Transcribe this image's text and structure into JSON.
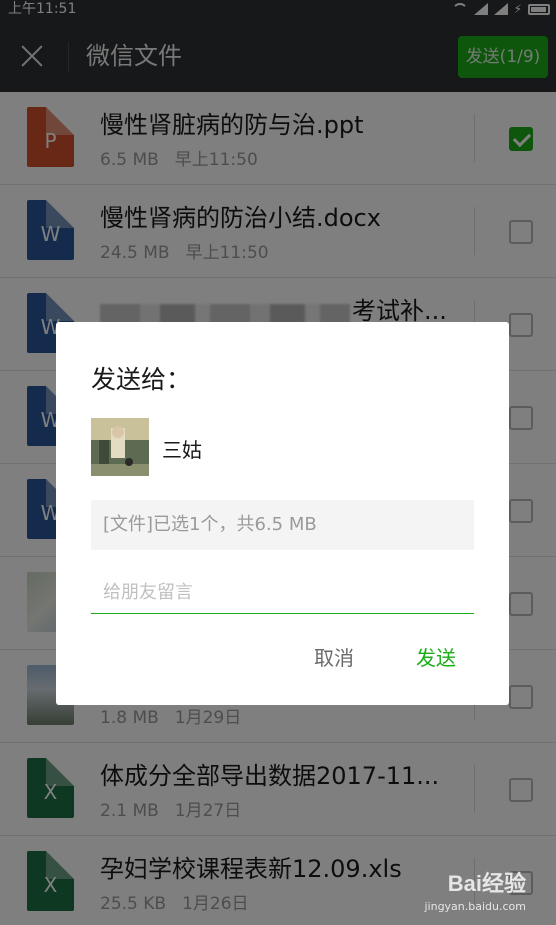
{
  "status_bar": {
    "time": "上午11:51"
  },
  "header": {
    "title": "微信文件",
    "send_button": "发送(1/9)"
  },
  "files": [
    {
      "icon": "P",
      "type": "ppt",
      "name": "慢性肾脏病的防与治.ppt",
      "size": "6.5 MB",
      "time": "早上11:50",
      "checked": true
    },
    {
      "icon": "W",
      "type": "word",
      "name": "慢性肾病的防治小结.docx",
      "size": "24.5 MB",
      "time": "早上11:50",
      "checked": false
    },
    {
      "icon": "W",
      "type": "word",
      "name": "考试补...",
      "size": "",
      "time": "",
      "checked": false
    },
    {
      "icon": "W",
      "type": "word",
      "name": "",
      "size": "",
      "time": "",
      "checked": false
    },
    {
      "icon": "W",
      "type": "word",
      "name": "",
      "size": "",
      "time": "",
      "checked": false
    },
    {
      "icon": "",
      "type": "image",
      "name": "",
      "size": "",
      "time": "",
      "checked": false
    },
    {
      "icon": "",
      "type": "image",
      "name": "",
      "size": "1.8 MB",
      "time": "1月29日",
      "checked": false
    },
    {
      "icon": "X",
      "type": "xls",
      "name": "体成分全部导出数据2017-11...",
      "size": "2.1 MB",
      "time": "1月27日",
      "checked": false
    },
    {
      "icon": "X",
      "type": "xls",
      "name": "孕妇学校课程表新12.09.xls",
      "size": "25.5 KB",
      "time": "1月26日",
      "checked": false
    }
  ],
  "dialog": {
    "title": "发送给：",
    "recipient": "三姑",
    "file_summary": "[文件]已选1个，共6.5 MB",
    "message_placeholder": "给朋友留言",
    "cancel": "取消",
    "send": "发送"
  },
  "watermark": {
    "logo": "Bai经验",
    "url": "jingyan.baidu.com"
  },
  "colors": {
    "accent": "#1aad19",
    "header_bg": "#2e3134"
  },
  "icons": [
    "close-icon",
    "wifi-icon",
    "signal-icon",
    "battery-icon",
    "checkmark-icon"
  ]
}
